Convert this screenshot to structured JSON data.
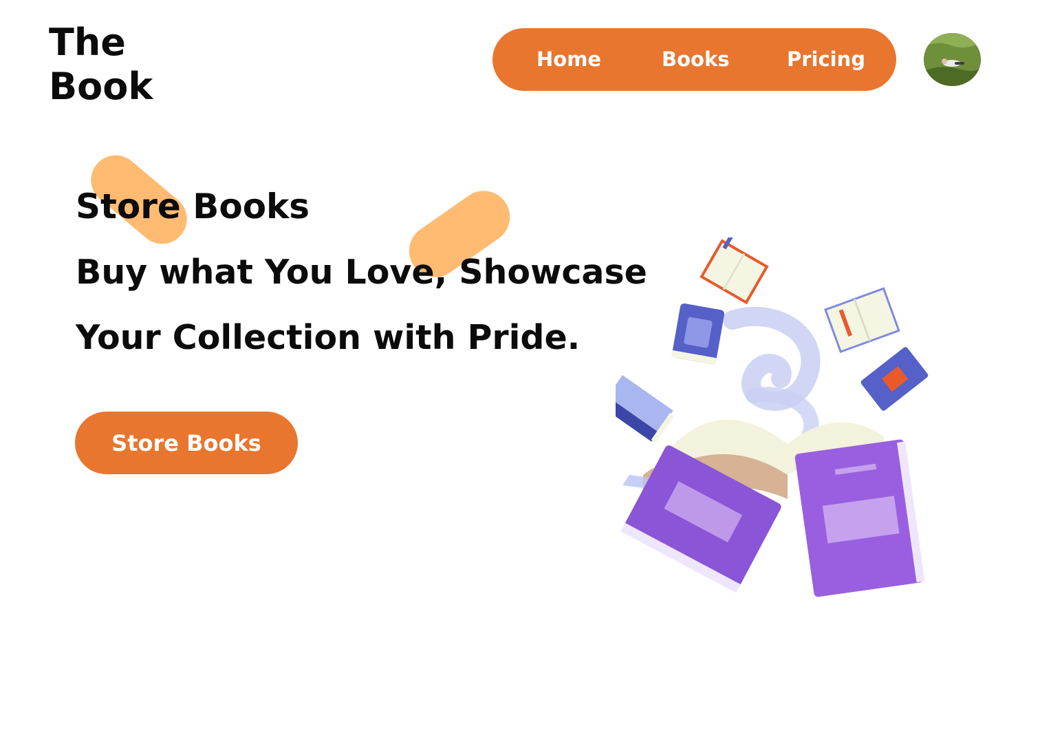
{
  "brand": {
    "line1": "The",
    "line2": "Book"
  },
  "nav": {
    "home": "Home",
    "books": "Books",
    "pricing": "Pricing"
  },
  "hero": {
    "headline": "Store Books",
    "tagline_line1": "Buy what You Love, Showcase",
    "tagline_line2": "Your Collection with Pride.",
    "cta_label": "Store Books"
  },
  "colors": {
    "accent": "#e8762e",
    "highlight": "#ffbb72",
    "text": "#0b0b0b",
    "book_purple": "#8a55d6",
    "book_blue": "#5560c8"
  },
  "icons": {
    "avatar": "user-avatar-photo",
    "illustration": "flying-books-illustration"
  }
}
